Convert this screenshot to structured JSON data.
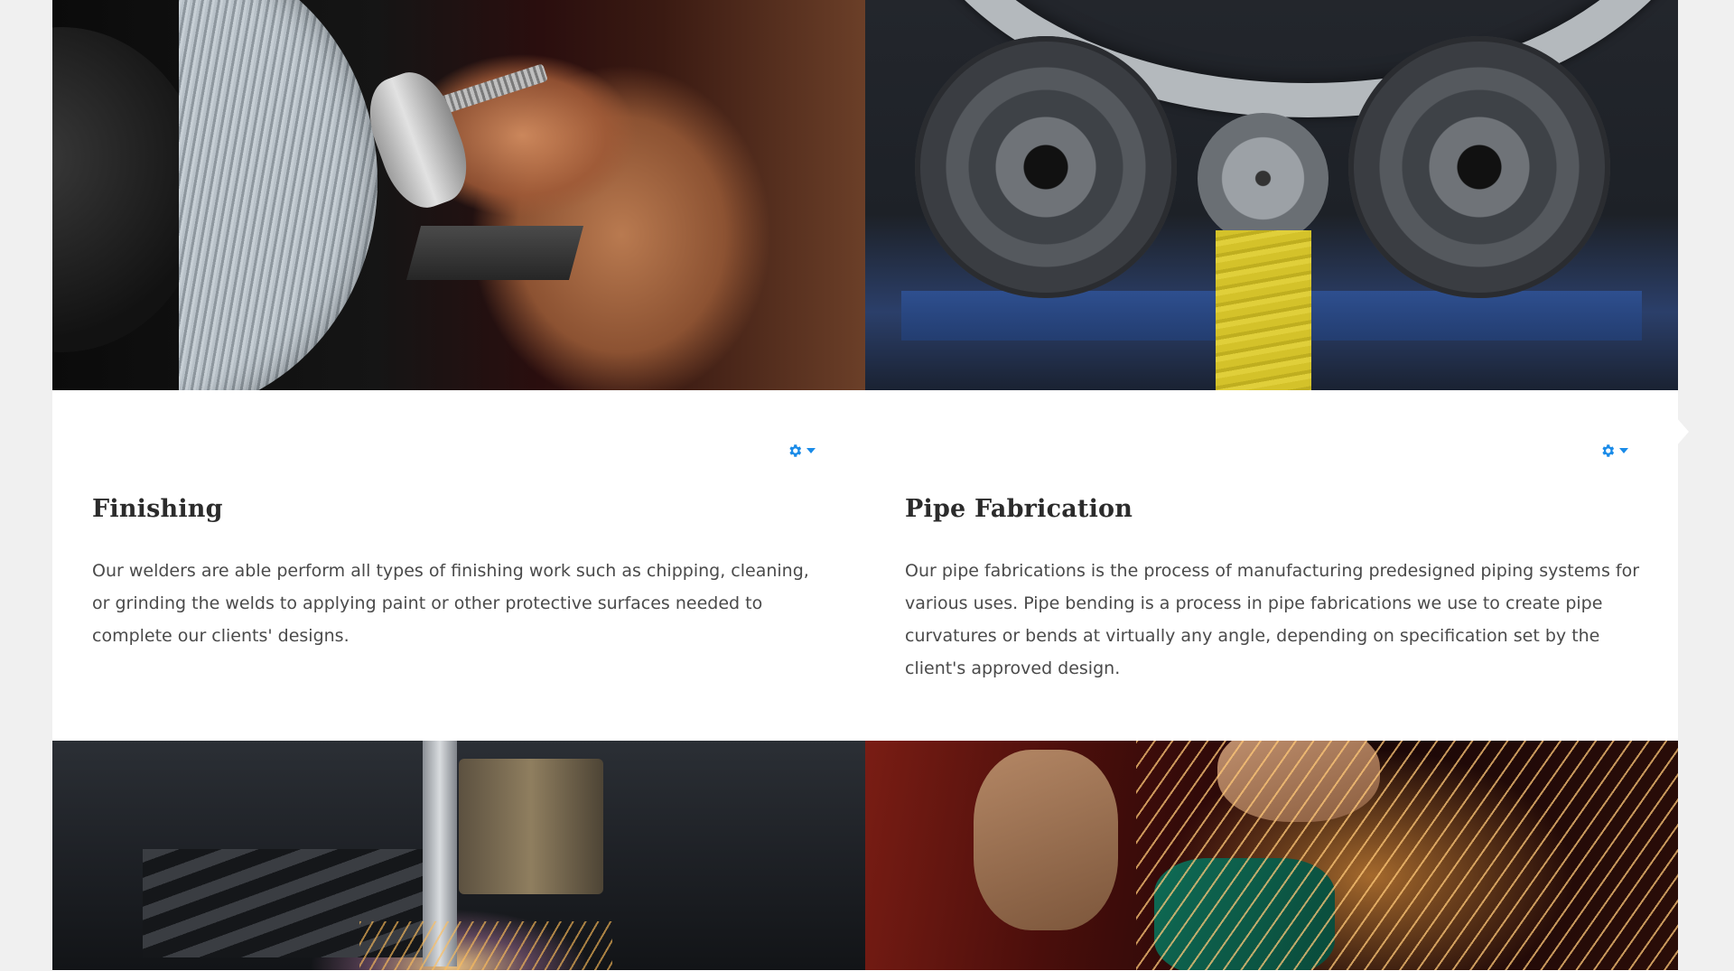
{
  "colors": {
    "page_bg": "#f0f0f0",
    "card_bg": "#ffffff",
    "accent": "#1a8be8",
    "heading": "#2b2b2b",
    "body_text": "#4a4a4a"
  },
  "cards": [
    {
      "title": "Finishing",
      "text": "Our welders are able perform all types of finishing work such as chipping, cleaning, or grinding the welds to applying paint or other protective surfaces needed to complete our clients' designs.",
      "image_icon": "grinding-wheel-image",
      "menu_icon": "gear-icon"
    },
    {
      "title": "Pipe Fabrication",
      "text": "Our pipe fabrications is the process of manufacturing predesigned piping systems for various uses. Pipe bending is a process in pipe fabrications we use to create pipe curvatures or bends at virtually any angle, depending on specification set by the client's approved design.",
      "image_icon": "pipe-bending-rollers-image",
      "menu_icon": "gear-icon"
    }
  ],
  "bottom_images": [
    {
      "image_icon": "plasma-cutter-image"
    },
    {
      "image_icon": "grinding-sparks-image"
    }
  ]
}
